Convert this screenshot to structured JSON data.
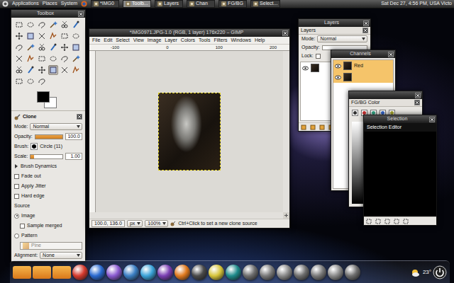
{
  "panel": {
    "menus": [
      "Applications",
      "Places",
      "System"
    ],
    "tasks": [
      {
        "label": "*IMG0",
        "selected": false
      },
      {
        "label": "Toolb...",
        "selected": true
      },
      {
        "label": "Layers",
        "selected": false
      },
      {
        "label": "Chan",
        "selected": false
      },
      {
        "label": "FG/BG",
        "selected": false
      },
      {
        "label": "Select...",
        "selected": false
      }
    ],
    "clock": "Sat Dec 27, 4:56 PM, USA Victo"
  },
  "toolbox": {
    "title": "Toolbox",
    "tools": [
      {
        "selected": false
      },
      {
        "selected": false
      },
      {
        "selected": false
      },
      {
        "selected": false
      },
      {
        "selected": false
      },
      {
        "selected": false
      },
      {
        "selected": false
      },
      {
        "selected": false
      },
      {
        "selected": false
      },
      {
        "selected": false
      },
      {
        "selected": false
      },
      {
        "selected": false
      },
      {
        "selected": false
      },
      {
        "selected": false
      },
      {
        "selected": false
      },
      {
        "selected": false
      },
      {
        "selected": false
      },
      {
        "selected": false
      },
      {
        "selected": false
      },
      {
        "selected": false
      },
      {
        "selected": false
      },
      {
        "selected": false
      },
      {
        "selected": false
      },
      {
        "selected": false
      },
      {
        "selected": false
      },
      {
        "selected": false
      },
      {
        "selected": false
      },
      {
        "selected": true
      },
      {
        "selected": false
      },
      {
        "selected": false
      },
      {
        "selected": false
      },
      {
        "selected": false
      },
      {
        "selected": false
      }
    ],
    "options": {
      "title": "Clone",
      "mode_label": "Mode:",
      "mode": "Normal",
      "opacity_label": "Opacity:",
      "opacity": "100.0",
      "opacity_level": 1.0,
      "brush_label": "Brush:",
      "brush": "Circle (11)",
      "scale_label": "Scale:",
      "scale": "1.00",
      "scale_level": 0.1,
      "dynamics": {
        "label": "Brush Dynamics",
        "expanded": false
      },
      "checks": [
        {
          "label": "Fade out",
          "checked": false
        },
        {
          "label": "Apply Jitter",
          "checked": false
        },
        {
          "label": "Hard edge",
          "checked": false
        }
      ],
      "source_label": "Source",
      "sources": [
        {
          "label": "Image",
          "checked": true,
          "kind": "radio"
        },
        {
          "label": "Sample merged",
          "checked": false,
          "kind": "checkbox"
        },
        {
          "label": "Pattern",
          "checked": false,
          "kind": "radio"
        }
      ],
      "pattern": {
        "label": "Pine",
        "disabled": true
      },
      "alignment_label": "Alignment:",
      "alignment": "None"
    }
  },
  "image_window": {
    "title": "*IMG0971.JPG-1.0 (RGB, 1 layer) 176x220 – GIMP",
    "menus": [
      "File",
      "Edit",
      "Select",
      "View",
      "Image",
      "Layer",
      "Colors",
      "Tools",
      "Filters",
      "Windows",
      "Help"
    ],
    "ruler": [
      "-100",
      "0",
      "100",
      "200"
    ],
    "status": {
      "coords": "100.0, 136.0",
      "unit": "px",
      "zoom": "100%",
      "message": "Ctrl+Click to set a new clone source"
    }
  },
  "layers": {
    "window_title": "Layers",
    "title": "Layers",
    "mode_label": "Mode:",
    "mode": "Normal",
    "opacity_label": "Opacity:",
    "lock_label": "Lock:"
  },
  "channels": {
    "window_title": "Channels",
    "rows": [
      {
        "label": "Red",
        "selected": true
      }
    ]
  },
  "fgbg": {
    "title": "FG/BG Color"
  },
  "selection": {
    "window_title": "Selection",
    "title": "Selection Editor"
  },
  "dock": {
    "temperature": "23°"
  }
}
